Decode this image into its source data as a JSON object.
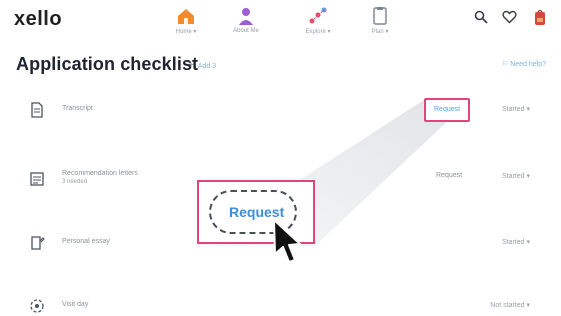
{
  "app": {
    "logo": "xello"
  },
  "nav": {
    "items": [
      {
        "label": "Home ▾",
        "icon": "home-icon"
      },
      {
        "label": "About Me",
        "icon": "person-icon"
      },
      {
        "label": "Explore ▾",
        "icon": "explore-icon"
      },
      {
        "label": "Plan ▾",
        "icon": "clipboard-icon"
      }
    ],
    "right_icons": [
      "search-icon",
      "heart-icon",
      "backpack-icon"
    ]
  },
  "page": {
    "title": "Application checklist",
    "add_label": "Add 3",
    "help_label": "Need help?"
  },
  "checklist": [
    {
      "name": "Transcript",
      "sub": "",
      "request": "",
      "status": "Started ▾"
    },
    {
      "name": "Recommendation letters",
      "sub": "3 needed",
      "request": "Request",
      "status": "Started ▾"
    },
    {
      "name": "Personal essay",
      "sub": "",
      "request": "",
      "status": "Started ▾"
    },
    {
      "name": "Visit day",
      "sub": "",
      "request": "",
      "status": "Not started ▾"
    }
  ],
  "highlight": {
    "request_small": "Request",
    "request_zoom": "Request"
  },
  "colors": {
    "accent_blue": "#3d8fd8",
    "highlight_pink": "#e0457b",
    "nav_home": "#f28a2e",
    "nav_about": "#9b5fd0",
    "nav_explore": "#e34f6e",
    "backpack": "#d2493f"
  }
}
